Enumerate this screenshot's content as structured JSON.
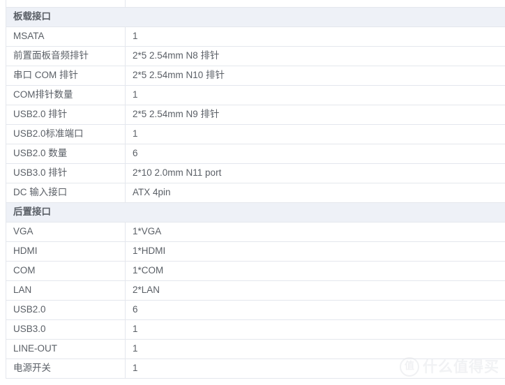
{
  "table": {
    "partial_row": {
      "label": "",
      "value": ""
    },
    "sections": [
      {
        "title": "板载接口",
        "rows": [
          {
            "label": "MSATA",
            "value": "1"
          },
          {
            "label": "前置面板音频排针",
            "value": "2*5 2.54mm N8 排针"
          },
          {
            "label": "串口 COM 排针",
            "value": "2*5 2.54mm N10 排针"
          },
          {
            "label": "COM排针数量",
            "value": "1"
          },
          {
            "label": "USB2.0 排针",
            "value": "2*5 2.54mm N9 排针"
          },
          {
            "label": "USB2.0标准端口",
            "value": "1"
          },
          {
            "label": "USB2.0 数量",
            "value": "6"
          },
          {
            "label": "USB3.0 排针",
            "value": "2*10 2.0mm N11 port"
          },
          {
            "label": "DC 输入接口",
            "value": "ATX 4pin"
          }
        ]
      },
      {
        "title": "后置接口",
        "rows": [
          {
            "label": "VGA",
            "value": "1*VGA"
          },
          {
            "label": "HDMI",
            "value": "1*HDMI"
          },
          {
            "label": "COM",
            "value": "1*COM"
          },
          {
            "label": "LAN",
            "value": "2*LAN"
          },
          {
            "label": "USB2.0",
            "value": "6"
          },
          {
            "label": "USB3.0",
            "value": "1"
          },
          {
            "label": "LINE-OUT",
            "value": "1"
          },
          {
            "label": "电源开关",
            "value": "1"
          }
        ]
      }
    ]
  },
  "watermark": {
    "badge": "值",
    "text": "什么值得买"
  },
  "colors": {
    "border": "#e4e7ed",
    "section_bg": "#eef1f7",
    "label_text": "#5a5f66",
    "value_text": "#5f646b",
    "watermark": "#e4e6ea"
  }
}
